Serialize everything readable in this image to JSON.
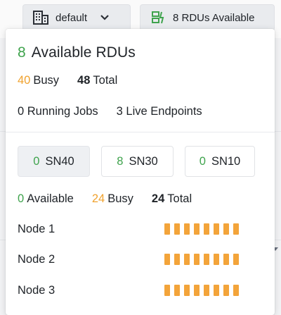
{
  "topbar": {
    "workspace": {
      "icon": "building-icon",
      "label": "default",
      "chevron": "chevron-down-icon"
    },
    "rdu_button": {
      "icon": "rdu-status-icon",
      "label": "8 RDUs Available"
    }
  },
  "popover": {
    "title_count": "8",
    "title_text": "Available RDUs",
    "summary": {
      "busy_count": "40",
      "busy_label": "Busy",
      "total_count": "48",
      "total_label": "Total"
    },
    "jobs": {
      "running": "0 Running Jobs",
      "endpoints": "3 Live Endpoints"
    },
    "chips": [
      {
        "count": "0",
        "label": "SN40",
        "active": true
      },
      {
        "count": "8",
        "label": "SN30",
        "active": false
      },
      {
        "count": "0",
        "label": "SN10",
        "active": false
      }
    ],
    "selected_stats": {
      "available_count": "0",
      "available_label": "Available",
      "busy_count": "24",
      "busy_label": "Busy",
      "total_count": "24",
      "total_label": "Total"
    },
    "nodes": [
      {
        "label": "Node 1",
        "busy_rdus": 8
      },
      {
        "label": "Node 2",
        "busy_rdus": 8
      },
      {
        "label": "Node 3",
        "busy_rdus": 8
      }
    ]
  },
  "colors": {
    "available": "#3fa34d",
    "busy": "#f0a22e",
    "bar": "#f3a43a"
  }
}
